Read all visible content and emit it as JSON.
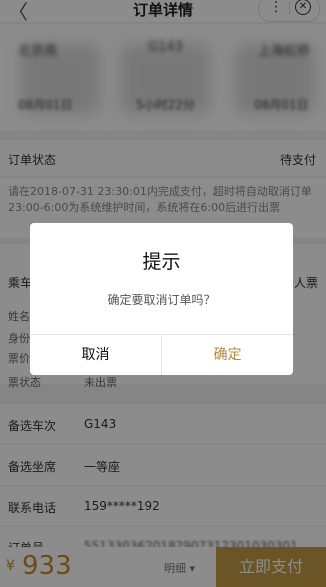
{
  "nav": {
    "back_glyph": "〈",
    "title": "订单详情",
    "more_glyph": "⋮",
    "close_glyph": "✕"
  },
  "trip": {
    "from_station": "北京南",
    "train_no": "G143",
    "to_station": "上海虹桥",
    "depart_date": "08月01日",
    "duration": "5小时22分",
    "arrive_date": "08月01日"
  },
  "order_status": {
    "label": "订单状态",
    "value": "待支付"
  },
  "notice": {
    "text": "请在2018-07-31 23:30:01内完成支付，超时将自动取消订单 23:00-6:00为系统维护时间，系统将在6:00后进行出票"
  },
  "passenger": {
    "header_label": "乘车",
    "header_right": "人票",
    "name_label": "姓名",
    "id_label": "身份",
    "price_label": "票价",
    "ticket_status_label": "票状态",
    "ticket_status_value": "未出票"
  },
  "alt_train": {
    "label": "备选车次",
    "value": "G143"
  },
  "alt_seat": {
    "label": "备选坐席",
    "value": "一等座"
  },
  "phone": {
    "label": "联系电话",
    "value": "159*****192"
  },
  "order_no": {
    "label": "订单号",
    "value": "5513303620182907312301030301"
  },
  "dialog": {
    "title": "提示",
    "message": "确定要取消订单吗？",
    "cancel": "取消",
    "confirm": "确定"
  },
  "bottom": {
    "currency": "¥",
    "amount": "933",
    "detail": "明细 ▾",
    "pay": "立即支付"
  },
  "colors": {
    "accent": "#c49a45",
    "confirm_text": "#b08a36"
  }
}
